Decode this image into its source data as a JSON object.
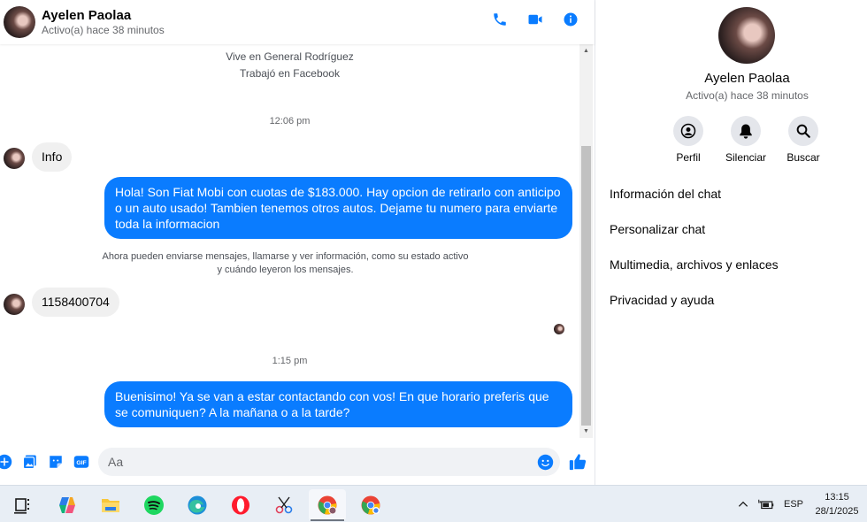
{
  "header": {
    "name": "Ayelen Paolaa",
    "status": "Activo(a) hace 38 minutos",
    "icons": [
      "phone-icon",
      "video-icon",
      "info-icon"
    ]
  },
  "intro": {
    "lines": [
      "Vive en General Rodríguez",
      "Trabajó en Facebook"
    ]
  },
  "messages": {
    "time_1": "12:06 pm",
    "info_msg": "Info",
    "out_1": "Hola! Son Fiat Mobi con cuotas de $183.000. Hay opcion de retirarlo con anticipo o un auto usado! Tambien tenemos otros autos. Dejame tu numero para enviarte toda la informacion",
    "system_line1": "Ahora pueden enviarse mensajes, llamarse y ver información, como su estado activo",
    "system_line2": "y cuándo leyeron los mensajes.",
    "number_msg": "1158400704",
    "time_2": "1:15 pm",
    "out_2": "Buenisimo! Ya se van a estar contactando con vos! En que horario preferis que se comuniquen? A la mañana o a la tarde?"
  },
  "composer": {
    "placeholder": "Aa",
    "icons": [
      "plus-icon",
      "photo-icon",
      "sticker-icon",
      "gif-icon",
      "emoji-icon",
      "like-icon"
    ],
    "gif_label": "GIF"
  },
  "panel": {
    "name": "Ayelen Paolaa",
    "status": "Activo(a) hace 38 minutos",
    "actions": [
      {
        "label": "Perfil",
        "icon": "profile-icon"
      },
      {
        "label": "Silenciar",
        "icon": "bell-icon"
      },
      {
        "label": "Buscar",
        "icon": "search-icon"
      }
    ],
    "menu": [
      "Información del chat",
      "Personalizar chat",
      "Multimedia, archivos y enlaces",
      "Privacidad y ayuda"
    ]
  },
  "taskbar": {
    "apps": [
      "task-view",
      "copilot",
      "file-explorer",
      "spotify",
      "edge",
      "opera",
      "snipping-tool",
      "chrome-profile",
      "chrome"
    ],
    "language": "ESP",
    "time": "13:15",
    "date": "28/1/2025"
  },
  "colors": {
    "accent": "#0a7cff",
    "incoming_bubble": "#f0f0f0",
    "panel_button": "#e4e6eb"
  }
}
